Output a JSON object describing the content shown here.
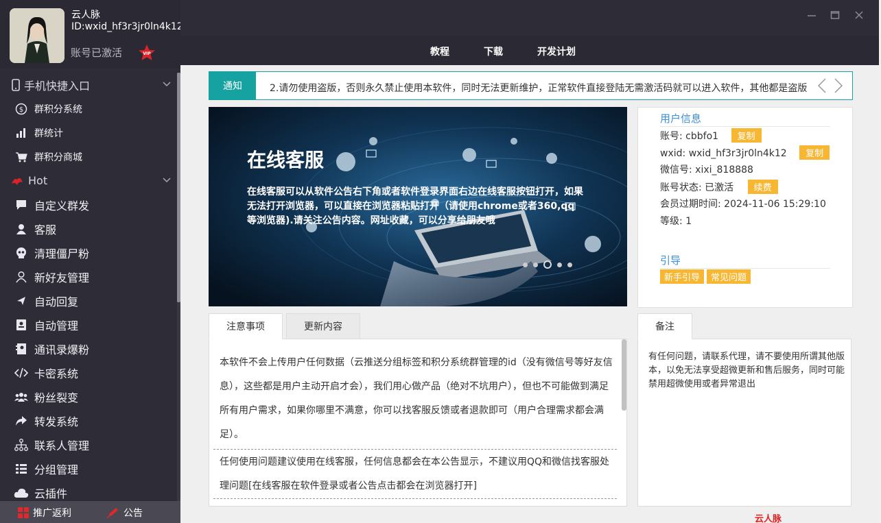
{
  "profile": {
    "name": "云人脉",
    "id": "ID:wxid_hf3r3jr0ln4k12",
    "status": "账号已激活",
    "vip": "VIP"
  },
  "menu": {
    "groups": [
      {
        "label": "手机快捷入口",
        "icon": "phone-icon"
      },
      {
        "label": "Hot",
        "icon": "hot-icon"
      }
    ],
    "phone_items": [
      {
        "label": "群积分系统",
        "icon": "coin-icon"
      },
      {
        "label": "群统计",
        "icon": "bar-chart-icon"
      },
      {
        "label": "群积分商城",
        "icon": "cart-icon"
      }
    ],
    "hot_items": [
      {
        "label": "自定义群发",
        "icon": "chat-icon"
      },
      {
        "label": "客服",
        "icon": "user-icon"
      },
      {
        "label": "清理僵尸粉",
        "icon": "skull-icon"
      },
      {
        "label": "新好友管理",
        "icon": "person-icon"
      },
      {
        "label": "自动回复",
        "icon": "send-icon"
      },
      {
        "label": "自动管理",
        "icon": "contact-card-icon"
      },
      {
        "label": "通讯录爆粉",
        "icon": "address-book-icon"
      },
      {
        "label": "卡密系统",
        "icon": "code-icon"
      },
      {
        "label": "粉丝裂变",
        "icon": "group-icon"
      },
      {
        "label": "转发系统",
        "icon": "forward-icon"
      },
      {
        "label": "联系人管理",
        "icon": "sitemap-icon"
      },
      {
        "label": "分组管理",
        "icon": "list-icon"
      },
      {
        "label": "云插件",
        "icon": "cloud-icon"
      }
    ]
  },
  "bottom": {
    "promo": "推广返利",
    "notice": "公告"
  },
  "nav": {
    "tutorial": "教程",
    "download": "下载",
    "plan": "开发计划"
  },
  "notice": {
    "tag": "通知",
    "text": "2.请勿使用盗版，否则永久禁止使用本软件，同时无法更新维护，正常软件直接登陆无需激活码就可以进入软件，其他都是盗版"
  },
  "banner": {
    "title": "在线客服",
    "desc": "在线客服可以从软件公告右下角或者软件登录界面右边在线客服按钮打开，如果无法打开浏览器，可以直接在浏览器粘贴打开（请使用chrome或者360,qq等浏览器).请关注公告内容。网址收藏，可以分享给朋友哦",
    "slides": 5,
    "active_slide": 3
  },
  "userinfo": {
    "heading": "用户信息",
    "account_label": "账号: ",
    "account": "cbbfo1",
    "wxid_label": "wxid: ",
    "wxid": "wxid_hf3r3jr0ln4k12",
    "wechat_label": "微信号: ",
    "wechat": "xixi_818888",
    "state_label": "账号状态: ",
    "state": "已激活",
    "expire_label": "会员过期时间: ",
    "expire": "2024-11-06 15:29:10",
    "level_label": "等级: ",
    "level": "1",
    "copy": "复制",
    "renew": "续费",
    "guide_heading": "引导",
    "guide_new": "新手引导",
    "guide_faq": "常见问题"
  },
  "tabs": {
    "notes": "注意事项",
    "updates": "更新内容",
    "remark": "备注"
  },
  "notes": {
    "p1": "本软件不会上传用户任何数据（云推送分组标签和积分系统群管理的id（没有微信号等好友信息），这些都是用户主动开启才会），我们用心做产品（绝对不坑用户），但也不可能做到满足所有用户需求，如果你哪里不满意，你可以找客服反馈或者退款即可（用户合理需求都会满足）。",
    "p2": "任何使用问题建议使用在线客服，任何信息都会在本公告显示，不建议用QQ和微信找客服处理问题[在线客服在软件登录或者公告点击都会在浏览器打开]"
  },
  "remark": {
    "text": "有任何问题，请联系代理，请不要使用所谓其他版本，以免无法享受超微更新和售后服务，同时可能禁用超微使用或者异常退出"
  },
  "watermark": "云人脉www.yunyunvip.com",
  "colors": {
    "sidebar": "#2e2c36",
    "teal": "#17a2a2",
    "yellow": "#f7b733",
    "link_blue": "#3b8ed8"
  }
}
